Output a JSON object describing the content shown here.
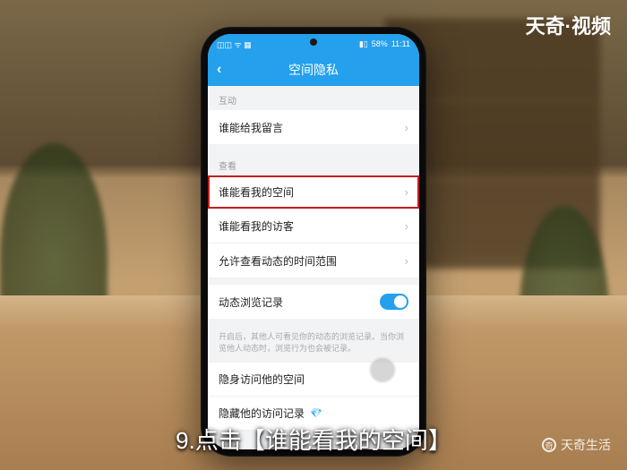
{
  "status_bar": {
    "time": "11:11",
    "battery": "58%",
    "carrier_icons": "◫◫ ᯤ ▦"
  },
  "title_bar": {
    "back": "‹",
    "title": "空间隐私"
  },
  "section1": {
    "label": "互动",
    "row_message": "谁能给我留言"
  },
  "section2": {
    "label": "查看",
    "row_view_space": "谁能看我的空间",
    "row_view_visitors": "谁能看我的访客",
    "row_time_range": "允许查看动态的时间范围"
  },
  "section3": {
    "row_browse_record": "动态浏览记录",
    "help": "开启后，其他人可看见你的动态的浏览记录。当你浏览他人动态时，浏览行为也会被记录。"
  },
  "section4": {
    "row_stealth": "隐身访问他的空间",
    "row_hide_record": "隐藏他的访问记录",
    "diamond": "💎"
  },
  "branding": {
    "top_right": "天奇·视频",
    "bottom_right": "天奇生活"
  },
  "caption": "9.点击【谁能看我的空间】"
}
